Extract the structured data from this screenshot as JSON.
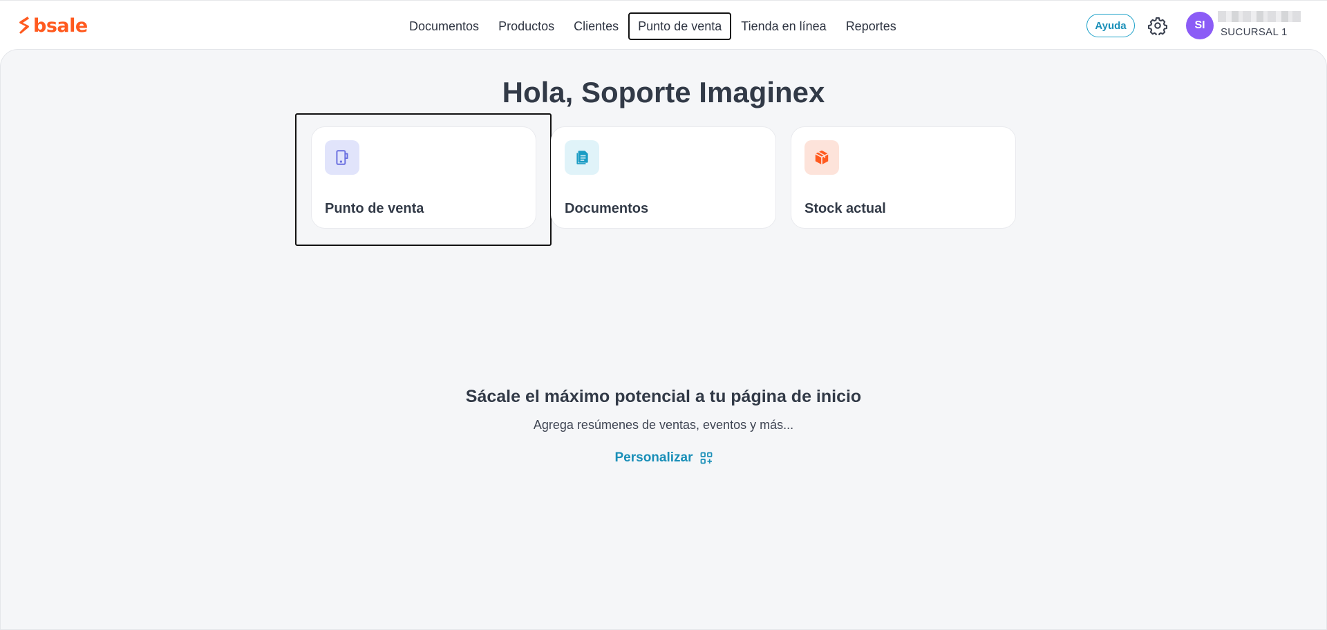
{
  "brand": {
    "name": "bsale",
    "color": "#ff5a1f"
  },
  "nav": {
    "items": [
      {
        "label": "Documentos",
        "active": false
      },
      {
        "label": "Productos",
        "active": false
      },
      {
        "label": "Clientes",
        "active": false
      },
      {
        "label": "Punto de venta",
        "active": true
      },
      {
        "label": "Tienda en línea",
        "active": false
      },
      {
        "label": "Reportes",
        "active": false
      }
    ]
  },
  "header": {
    "help_label": "Ayuda",
    "settings_icon": "gear-icon",
    "avatar_initials": "SI",
    "avatar_color": "#8b5cf6",
    "branch": "SUCURSAL 1"
  },
  "main": {
    "greeting": "Hola, Soporte Imaginex",
    "cards": [
      {
        "label": "Punto de venta",
        "icon": "pos-device-icon",
        "icon_bg": "#e1e4fb",
        "icon_color": "#6a6fe0"
      },
      {
        "label": "Documentos",
        "icon": "documents-icon",
        "icon_bg": "#e0f3f9",
        "icon_color": "#1a9cc4"
      },
      {
        "label": "Stock actual",
        "icon": "box-icon",
        "icon_bg": "#fde3da",
        "icon_color": "#ff5a1f"
      }
    ],
    "promo": {
      "title": "Sácale el máximo potencial a tu página de inicio",
      "subtitle": "Agrega resúmenes de ventas, eventos y más...",
      "customize_label": "Personalizar",
      "customize_icon": "widgets-add-icon"
    }
  }
}
